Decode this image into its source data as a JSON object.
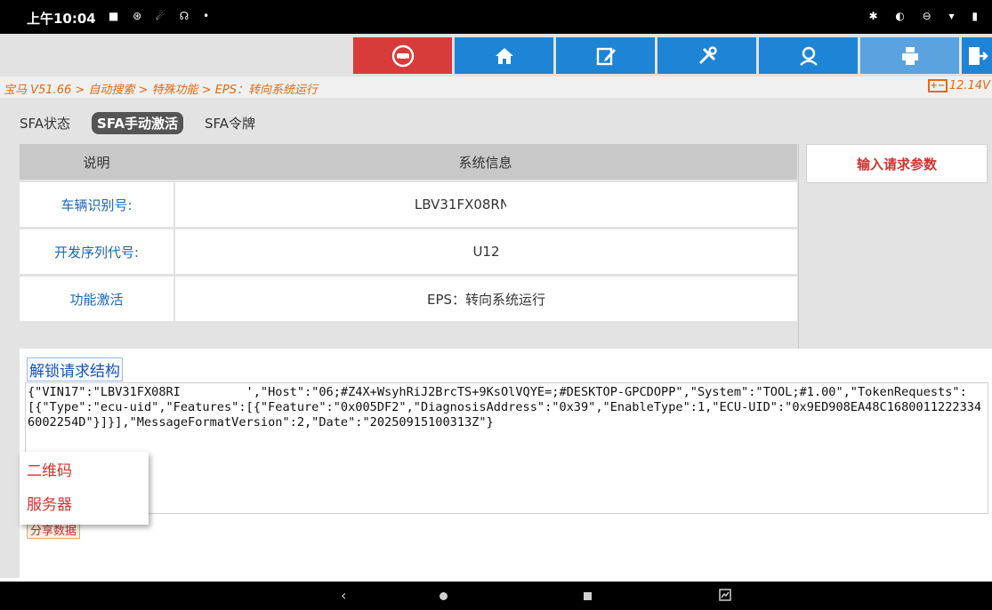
{
  "status_bar": {
    "time": "上午10:04",
    "left_icons": "■ ⊛ ☄ ☊ •",
    "right_icons": "✱ ◐ ⊖ ▾ ▮"
  },
  "toolbar": {
    "buttons": [
      "car-diagnose-icon",
      "home-icon",
      "edit-report-icon",
      "tools-icon",
      "remote-expert-icon",
      "print-icon",
      "exit-icon"
    ],
    "colors": {
      "primary": "#1e84d6",
      "active": "#d93a3a"
    }
  },
  "breadcrumb": {
    "path": "宝马 V51.66 > 自动搜索 > 特殊功能 > EPS：转向系统运行",
    "battery_icon_text": "+−",
    "voltage": "12.14V"
  },
  "tabs": [
    {
      "label": "SFA状态",
      "active": false
    },
    {
      "label": "SFA手动激活",
      "active": true
    },
    {
      "label": "SFA令牌",
      "active": false
    }
  ],
  "table": {
    "headers": [
      "说明",
      "系统信息"
    ],
    "rows": [
      {
        "label": "车辆识别号:",
        "value": "LBV31FX08RN"
      },
      {
        "label": "开发序列代号:",
        "value": "U12"
      },
      {
        "label": "功能激活",
        "value": "EPS：转向系统运行"
      }
    ]
  },
  "side": {
    "request_button": "输入请求参数"
  },
  "unlock": {
    "title": "解锁请求结构",
    "content": "{\"VIN17\":\"LBV31FX08RI         ',\"Host\":\"06;#Z4X+WsyhRiJ2BrcTS+9KsOlVQYE=;#DESKTOP-GPCDOPP\",\"System\":\"TOOL;#1.00\",\"TokenRequests\":[{\"Type\":\"ecu-uid\",\"Features\":[{\"Feature\":\"0x005DF2\",\"DiagnosisAddress\":\"0x39\",\"EnableType\":1,\"ECU-UID\":\"0x9ED908EA48C16800112223346002254D\"}]}],\"MessageFormatVersion\":2,\"Date\":\"20250915100313Z\"}",
    "share_button": "分享数据"
  },
  "popup_menu": {
    "items": [
      "二维码",
      "服务器"
    ]
  },
  "nav_bar": {
    "back": "‹",
    "recents_icon": "screenshot-icon"
  }
}
